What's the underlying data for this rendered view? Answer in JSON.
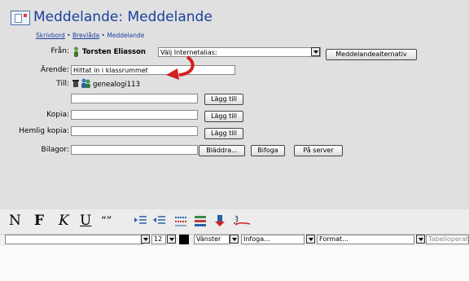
{
  "header": {
    "title": "Meddelande: Meddelande",
    "breadcrumb": [
      "Skrivbord",
      "Brevlåda",
      "Meddelande"
    ],
    "sep": "•"
  },
  "form": {
    "from_label": "Från:",
    "from_name": "Torsten Eliasson",
    "alias_placeholder": "Välj Internetalias:",
    "message_options_label": "Meddelandealternativ",
    "subject_label": "Ärende:",
    "subject_value": "Hittat in i klassrummet",
    "to_label": "Till:",
    "to_value": "genealogi113",
    "add_label": "Lägg till",
    "cc_label": "Kopia:",
    "bcc_label": "Hemlig kopia:",
    "attachments_label": "Bilagor:",
    "browse_label": "Bläddra...",
    "attach_label": "Bifoga",
    "on_server_label": "På server"
  },
  "toolbar": {
    "bold": "N",
    "bold2": "F",
    "italic": "K",
    "underline": "U",
    "quote": "“”"
  },
  "format_bar": {
    "font_size": "12",
    "align": "Vänster",
    "insert": "Infoga...",
    "format": "Format...",
    "table_ops": "Tabelloperat"
  },
  "colors": {
    "title": "#1a3f9e",
    "arrow": "#d42020"
  }
}
